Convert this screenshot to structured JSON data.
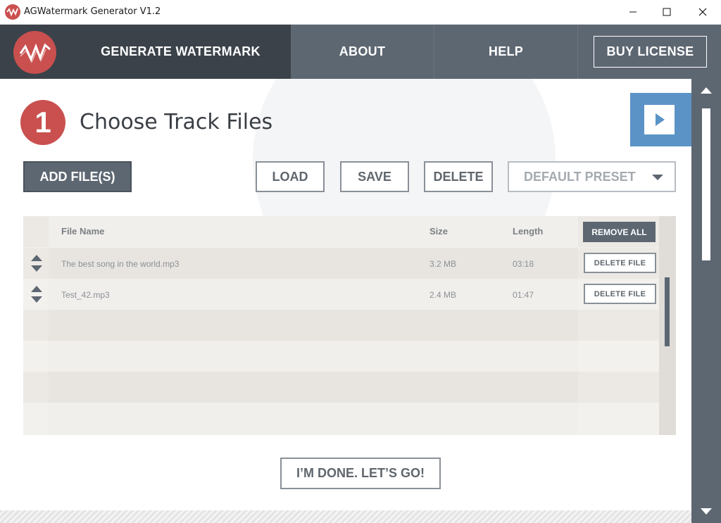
{
  "window": {
    "title": "AGWatermark Generator V1.2"
  },
  "nav": {
    "items": [
      {
        "label": "GENERATE WATERMARK",
        "active": true
      },
      {
        "label": "ABOUT",
        "active": false
      },
      {
        "label": "HELP",
        "active": false
      }
    ],
    "buy_label": "BUY LICENSE"
  },
  "step": {
    "number": "1",
    "title": "Choose Track Files"
  },
  "toolbar": {
    "add_files": "ADD FILE(S)",
    "load": "LOAD",
    "save": "SAVE",
    "delete": "DELETE",
    "preset": "DEFAULT PRESET"
  },
  "table": {
    "headers": {
      "name": "File Name",
      "size": "Size",
      "length": "Length",
      "remove_all": "REMOVE ALL"
    },
    "rows": [
      {
        "name": "The best song in the world.mp3",
        "size": "3.2 MB",
        "length": "03:18",
        "action": "DELETE FILE"
      },
      {
        "name": "Test_42.mp3",
        "size": "2.4 MB",
        "length": "01:47",
        "action": "DELETE FILE"
      }
    ]
  },
  "done_label": "I’M DONE. LET’S GO!",
  "colors": {
    "brand_red": "#c9504f",
    "nav_dark": "#3b424a",
    "nav": "#5d6772",
    "accent_blue": "#5b93c6"
  },
  "icons": {
    "app": "waveform-logo-icon",
    "play": "play-icon",
    "reorder": "up-down-arrows-icon",
    "dropdown": "chevron-down-icon"
  }
}
